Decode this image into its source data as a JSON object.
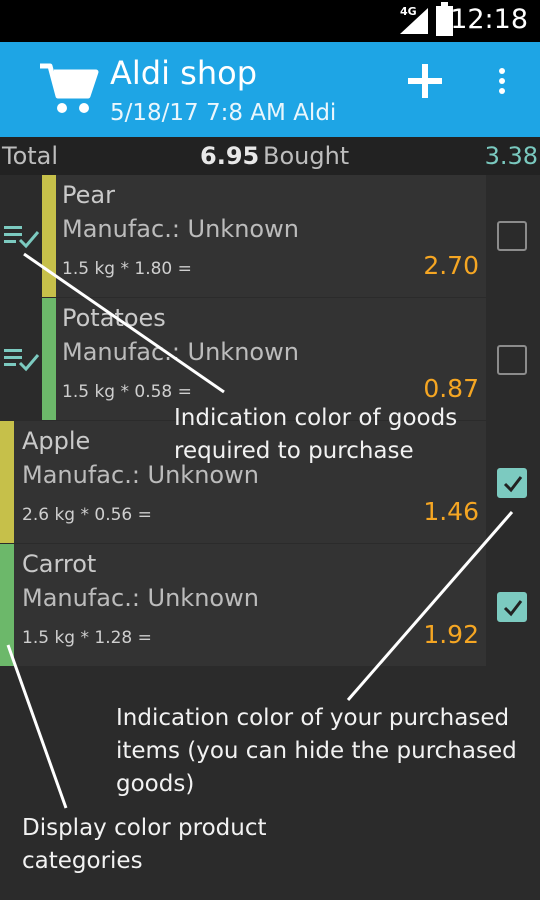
{
  "status_bar": {
    "network": "4G",
    "time": "12:18"
  },
  "app_bar": {
    "title": "Aldi shop",
    "subtitle": "5/18/17 7:8 AM Aldi"
  },
  "totals": {
    "total_label": "Total",
    "total_value": "6.95",
    "bought_label": "Bought",
    "bought_value": "3.38"
  },
  "items": [
    {
      "name": "Pear",
      "manufacturer": "Manufac.: Unknown",
      "formula": "1.5 kg * 1.80 =",
      "price": "2.70",
      "category_color": "#c6c04a",
      "required": true,
      "checked": false
    },
    {
      "name": "Potatoes",
      "manufacturer": "Manufac.: Unknown",
      "formula": "1.5 kg * 0.58 =",
      "price": "0.87",
      "category_color": "#6cb86a",
      "required": true,
      "checked": false
    },
    {
      "name": "Apple",
      "manufacturer": "Manufac.: Unknown",
      "formula": "2.6 kg * 0.56 =",
      "price": "1.46",
      "category_color": "#c6c04a",
      "required": false,
      "checked": true
    },
    {
      "name": "Carrot",
      "manufacturer": "Manufac.: Unknown",
      "formula": "1.5 kg * 1.28 =",
      "price": "1.92",
      "category_color": "#6cb86a",
      "required": false,
      "checked": true
    }
  ],
  "annotations": {
    "required": "Indication color of goods required to purchase",
    "purchased": "Indication color of your purchased items (you can hide the purchased goods)",
    "categories": "Display color product categories"
  },
  "colors": {
    "app_bar": "#1ea5e5",
    "background": "#2b2b2b",
    "price": "#f5a623",
    "checked": "#7ccac0"
  },
  "icons": {
    "cart": "shopping-cart-icon",
    "add": "plus-icon",
    "more": "overflow-menu-icon",
    "required": "list-check-icon"
  }
}
